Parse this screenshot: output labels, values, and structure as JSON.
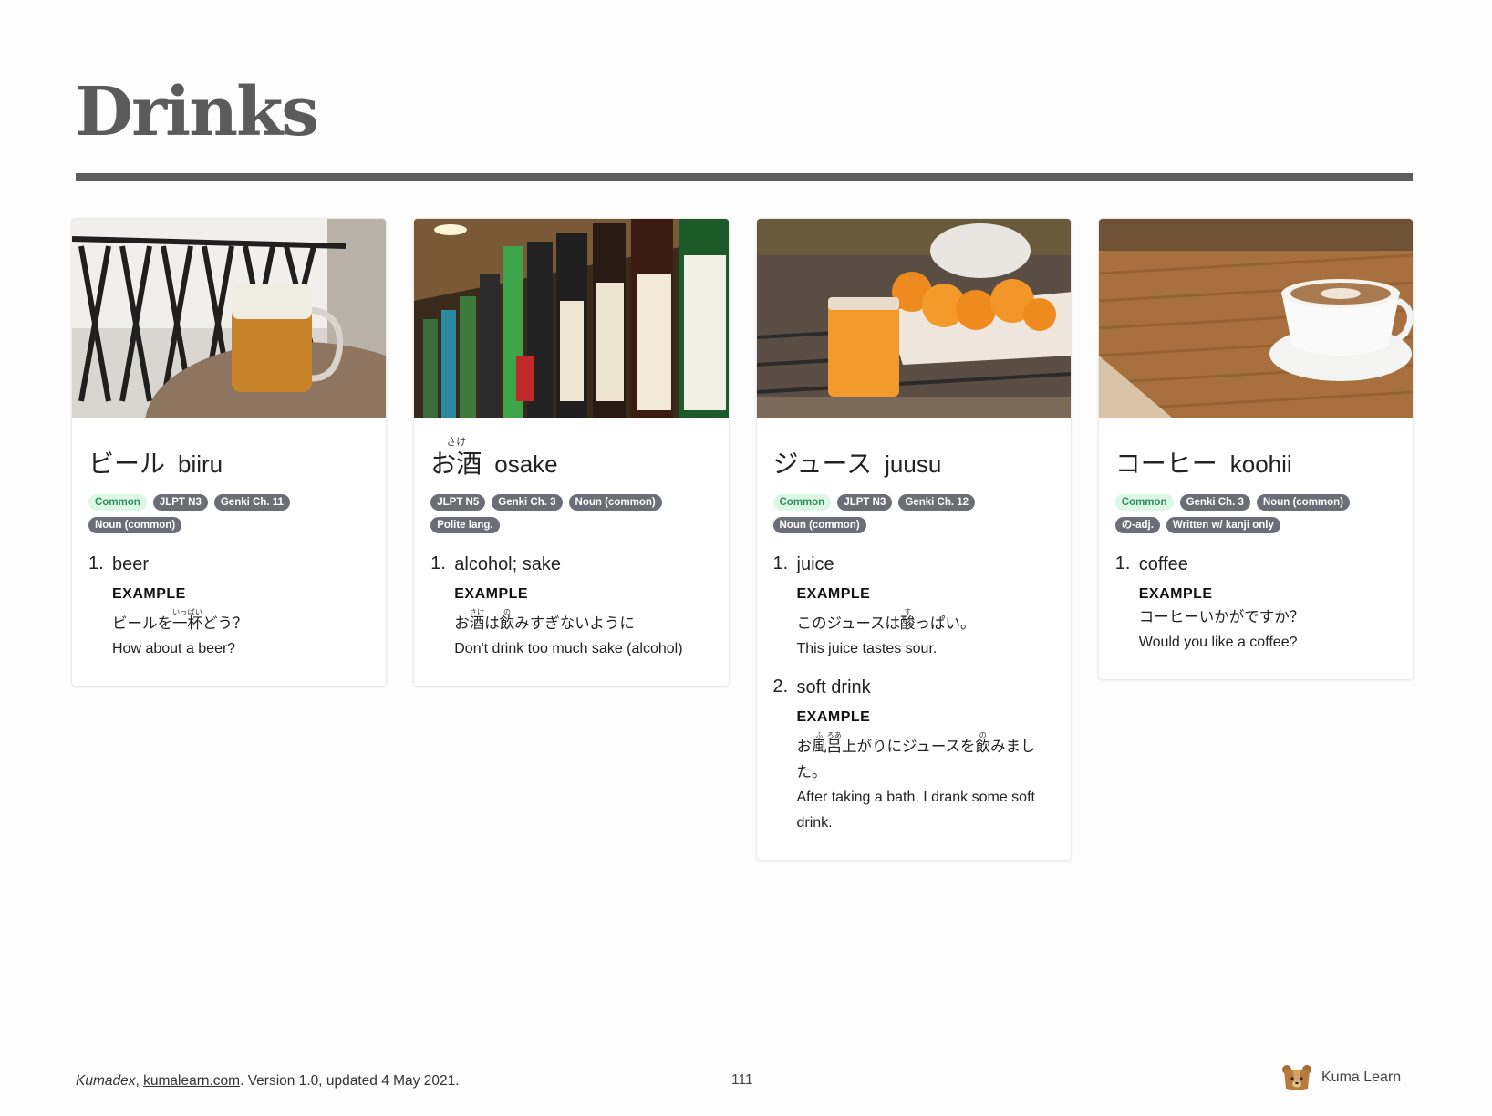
{
  "page": {
    "title": "Drinks",
    "page_number": "111"
  },
  "cards": [
    {
      "image_alt": "beer-mug-photo",
      "word_jp": "ビール",
      "word_furigana": "",
      "romaji": "biiru",
      "tags": [
        {
          "label": "Common",
          "kind": "common"
        },
        {
          "label": "JLPT N3",
          "kind": "default"
        },
        {
          "label": "Genki Ch. 11",
          "kind": "default"
        },
        {
          "label": "Noun (common)",
          "kind": "default"
        }
      ],
      "senses": [
        {
          "num": "1.",
          "gloss": "beer",
          "example_label": "EXAMPLE",
          "example_jp_parts": [
            {
              "text": "ビールを"
            },
            {
              "text": "一杯",
              "ruby": "いっぱい"
            },
            {
              "text": "どう？"
            }
          ],
          "example_en": "How about a beer?"
        }
      ]
    },
    {
      "image_alt": "sake-bottles-photo",
      "word_jp": "お酒",
      "word_furigana": "さけ",
      "romaji": "osake",
      "tags": [
        {
          "label": "JLPT N5",
          "kind": "default"
        },
        {
          "label": "Genki Ch. 3",
          "kind": "default"
        },
        {
          "label": "Noun (common)",
          "kind": "default"
        },
        {
          "label": "Polite lang.",
          "kind": "default"
        }
      ],
      "senses": [
        {
          "num": "1.",
          "gloss": "alcohol; sake",
          "example_label": "EXAMPLE",
          "example_jp_parts": [
            {
              "text": "お"
            },
            {
              "text": "酒",
              "ruby": "さけ"
            },
            {
              "text": "は"
            },
            {
              "text": "飲",
              "ruby": "の"
            },
            {
              "text": "みすぎないように"
            }
          ],
          "example_en": "Don't drink too much sake (alcohol)"
        }
      ]
    },
    {
      "image_alt": "orange-juice-photo",
      "word_jp": "ジュース",
      "word_furigana": "",
      "romaji": "juusu",
      "tags": [
        {
          "label": "Common",
          "kind": "common"
        },
        {
          "label": "JLPT N3",
          "kind": "default"
        },
        {
          "label": "Genki Ch. 12",
          "kind": "default"
        },
        {
          "label": "Noun (common)",
          "kind": "default"
        }
      ],
      "senses": [
        {
          "num": "1.",
          "gloss": "juice",
          "example_label": "EXAMPLE",
          "example_jp_parts": [
            {
              "text": "このジュースは"
            },
            {
              "text": "酸",
              "ruby": "す"
            },
            {
              "text": "っぱい。"
            }
          ],
          "example_en": "This juice tastes sour."
        },
        {
          "num": "2.",
          "gloss": "soft drink",
          "example_label": "EXAMPLE",
          "example_jp_parts": [
            {
              "text": "お"
            },
            {
              "text": "風",
              "ruby": "ふ"
            },
            {
              "text": "呂",
              "ruby": "ろあ"
            },
            {
              "text": "上がりにジュースを"
            },
            {
              "text": "飲",
              "ruby": "の"
            },
            {
              "text": "みました。"
            }
          ],
          "example_en": "After taking a bath, I drank some soft drink."
        }
      ]
    },
    {
      "image_alt": "coffee-cup-photo",
      "word_jp": "コーヒー",
      "word_furigana": "",
      "romaji": "koohii",
      "tags": [
        {
          "label": "Common",
          "kind": "common"
        },
        {
          "label": "Genki Ch. 3",
          "kind": "default"
        },
        {
          "label": "Noun (common)",
          "kind": "default"
        },
        {
          "label": "の-adj.",
          "kind": "default"
        },
        {
          "label": "Written w/ kanji only",
          "kind": "default"
        }
      ],
      "senses": [
        {
          "num": "1.",
          "gloss": "coffee",
          "example_label": "EXAMPLE",
          "example_jp_parts": [
            {
              "text": "コーヒーいかがですか？"
            }
          ],
          "example_en": "Would you like a coffee?"
        }
      ]
    }
  ],
  "footer": {
    "source_title": "Kumadex",
    "link_text": "kumalearn.com",
    "version_text": ". Version 1.0, updated 4 May 2021.",
    "brand_name": "Kuma Learn",
    "brand_icon": "bear-logo-icon"
  },
  "colors": {
    "title": "#5b5b5b",
    "tag_default_bg": "#6b6e76",
    "tag_common_bg": "#dcf7e6",
    "tag_common_text": "#2f8f57"
  }
}
